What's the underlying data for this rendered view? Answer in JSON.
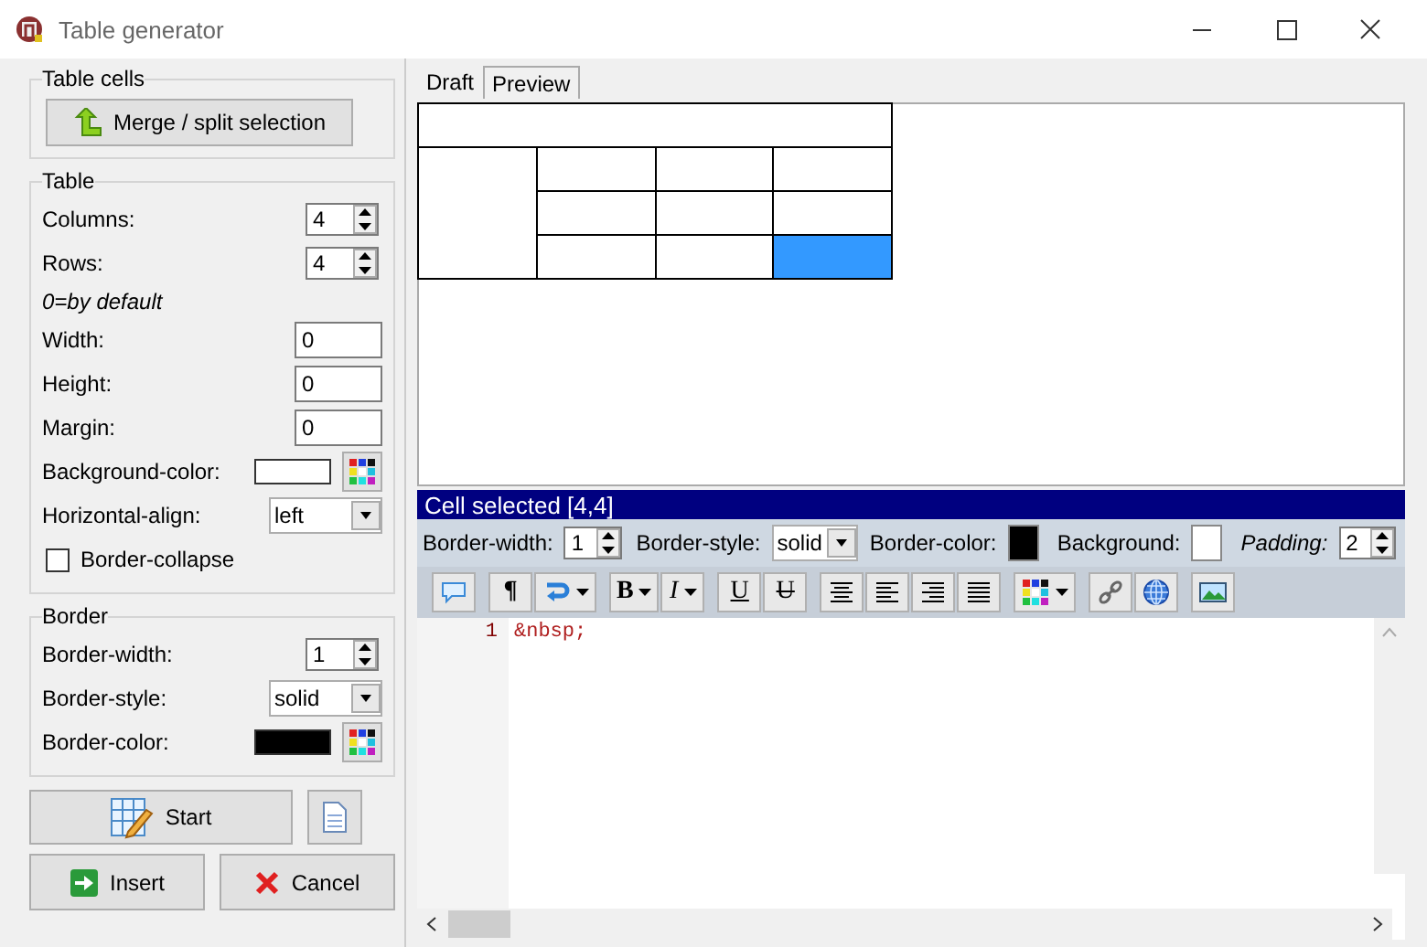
{
  "window": {
    "title": "Table generator"
  },
  "table_cells": {
    "title": "Table cells",
    "merge_button": "Merge / split selection"
  },
  "table": {
    "title": "Table",
    "fields": [
      {
        "kind": "spin",
        "label": "Columns:",
        "value": "4"
      },
      {
        "kind": "spin",
        "label": "Rows:",
        "value": "4"
      },
      {
        "kind": "note",
        "label": "0=by default"
      },
      {
        "kind": "text",
        "label": "Width:",
        "value": "0"
      },
      {
        "kind": "text",
        "label": "Height:",
        "value": "0"
      },
      {
        "kind": "text",
        "label": "Margin:",
        "value": "0"
      },
      {
        "kind": "color",
        "label": "Background-color:",
        "color": "#ffffff"
      },
      {
        "kind": "select",
        "label": "Horizontal-align:",
        "value": "left"
      },
      {
        "kind": "checkbox",
        "label": "Border-collapse",
        "checked": false
      }
    ]
  },
  "border": {
    "title": "Border",
    "fields": [
      {
        "kind": "spin",
        "label": "Border-width:",
        "value": "1"
      },
      {
        "kind": "select",
        "label": "Border-style:",
        "value": "solid"
      },
      {
        "kind": "color",
        "label": "Border-color:",
        "color": "#000000"
      }
    ]
  },
  "buttons": {
    "start": "Start",
    "insert": "Insert",
    "cancel": "Cancel"
  },
  "tabs": [
    {
      "label": "Draft",
      "selected": true
    },
    {
      "label": "Preview",
      "selected": false
    }
  ],
  "draft_table": {
    "rows": [
      [
        {
          "kind": "wide",
          "selected": false
        }
      ],
      [
        {
          "kind": "tall",
          "selected": false
        },
        {
          "kind": "cell",
          "selected": false
        },
        {
          "kind": "cell",
          "selected": false
        },
        {
          "kind": "cell",
          "selected": false
        }
      ],
      [
        {
          "kind": "cell",
          "selected": false
        },
        {
          "kind": "cell",
          "selected": false
        },
        {
          "kind": "cell",
          "selected": false
        }
      ],
      [
        {
          "kind": "cell",
          "selected": false
        },
        {
          "kind": "cell",
          "selected": false
        },
        {
          "kind": "cell",
          "selected": true
        }
      ]
    ]
  },
  "cell_panel": {
    "title": "Cell selected [4,4]",
    "fields": [
      {
        "kind": "spin",
        "label": "Border-width:",
        "value": "1",
        "emphasis": false
      },
      {
        "kind": "select",
        "label": "Border-style:",
        "value": "solid",
        "emphasis": false
      },
      {
        "kind": "color",
        "label": "Border-color:",
        "color": "#000000",
        "emphasis": false
      },
      {
        "kind": "color",
        "label": "Background:",
        "color": "#ffffff",
        "emphasis": false
      },
      {
        "kind": "spin",
        "label": "Padding:",
        "value": "2",
        "emphasis": true
      }
    ]
  },
  "toolbar": [
    [
      {
        "kind": "bubble"
      }
    ],
    [
      {
        "kind": "bold",
        "label": "¶"
      },
      {
        "kind": "wrap",
        "dropdown": true
      }
    ],
    [
      {
        "kind": "bold",
        "label": "B",
        "dropdown": true
      },
      {
        "kind": "italic",
        "label": "I",
        "dropdown": true
      }
    ],
    [
      {
        "kind": "underline",
        "label": "U"
      },
      {
        "kind": "strike",
        "label": "U"
      }
    ],
    [
      {
        "kind": "align-center"
      },
      {
        "kind": "align-left"
      },
      {
        "kind": "align-right"
      },
      {
        "kind": "justify"
      }
    ],
    [
      {
        "kind": "palette",
        "dropdown": true
      }
    ],
    [
      {
        "kind": "link"
      },
      {
        "kind": "globe"
      }
    ],
    [
      {
        "kind": "image"
      }
    ]
  ],
  "editor": {
    "lines": [
      {
        "number": "1",
        "text": "&nbsp;"
      }
    ]
  }
}
